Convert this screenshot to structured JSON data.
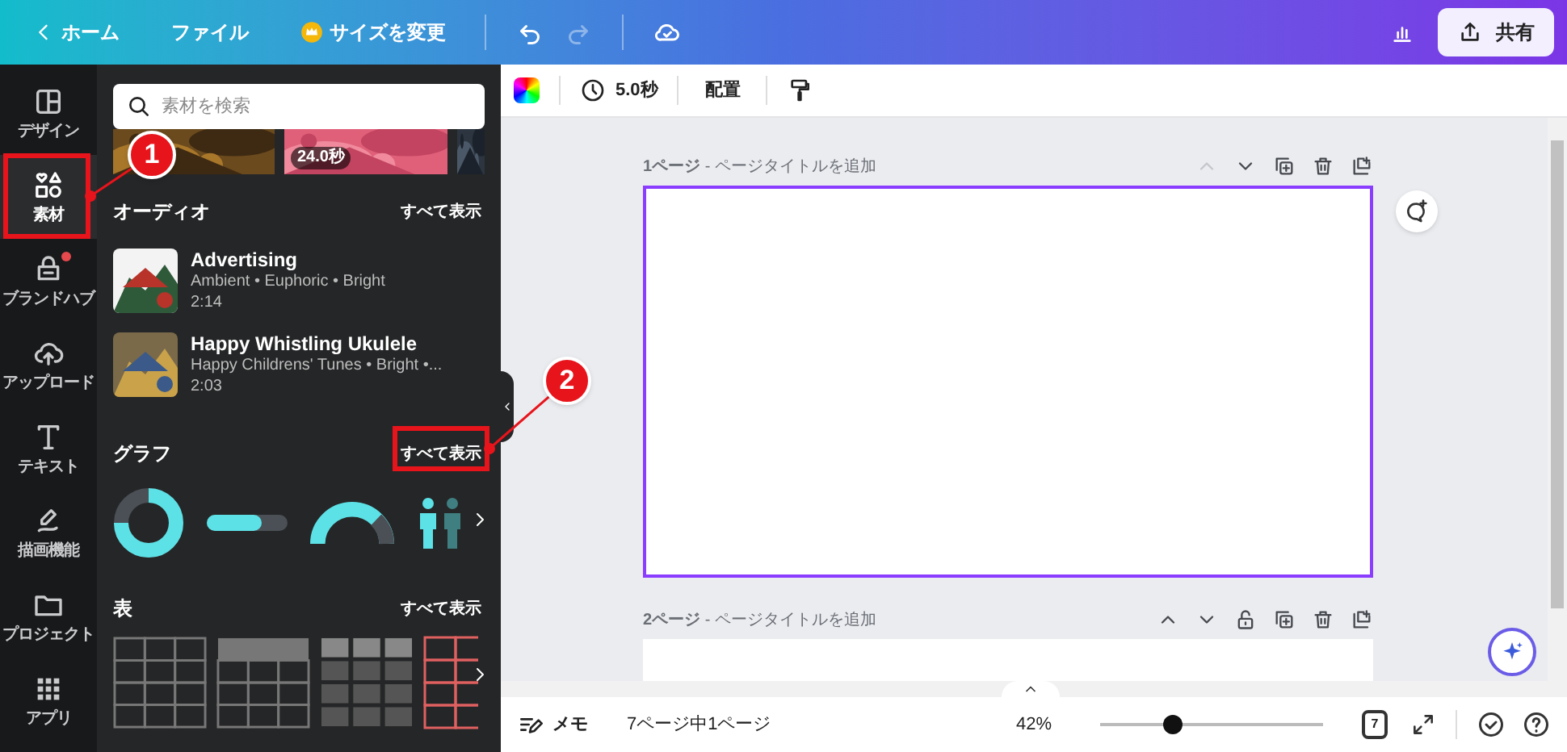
{
  "topbar": {
    "items": [
      {
        "kind": "back",
        "label": "ホーム"
      },
      {
        "kind": "plain",
        "label": "ファイル"
      },
      {
        "kind": "crown",
        "label": "サイズを変更"
      }
    ],
    "share": "共有"
  },
  "rail": [
    {
      "kind": "design",
      "label": "デザイン",
      "selected": false,
      "badge": false
    },
    {
      "kind": "elements",
      "label": "素材",
      "selected": true,
      "badge": false
    },
    {
      "kind": "brand",
      "label": "ブランドハブ",
      "selected": false,
      "badge": true
    },
    {
      "kind": "upload",
      "label": "アップロード",
      "selected": false,
      "badge": false
    },
    {
      "kind": "text",
      "label": "テキスト",
      "selected": false,
      "badge": false
    },
    {
      "kind": "draw",
      "label": "描画機能",
      "selected": false,
      "badge": false
    },
    {
      "kind": "folder",
      "label": "プロジェクト",
      "selected": false,
      "badge": false
    },
    {
      "kind": "apps",
      "label": "アプリ",
      "selected": false,
      "badge": false
    }
  ],
  "panel": {
    "search": {
      "placeholder": "素材を検索"
    },
    "video_badge": "24.0秒",
    "audio": {
      "title": "オーディオ",
      "link": "すべて表示",
      "tracks": [
        {
          "title": "Advertising",
          "subtitle": "Ambient • Euphoric • Bright",
          "duration": "2:14"
        },
        {
          "title": "Happy Whistling Ukulele",
          "subtitle": "Happy Childrens' Tunes • Bright •...",
          "duration": "2:03"
        }
      ]
    },
    "graph": {
      "title": "グラフ",
      "link": "すべて表示"
    },
    "table": {
      "title": "表",
      "link": "すべて表示"
    }
  },
  "toolbar": {
    "duration": "5.0秒",
    "arrange": "配置"
  },
  "pages": [
    {
      "title": "**1ページ** - ページタイトルを追加",
      "selected": true,
      "actions": [
        {
          "kind": "up",
          "disabled": true
        },
        {
          "kind": "down",
          "disabled": false
        },
        {
          "kind": "duplicate",
          "disabled": false
        },
        {
          "kind": "trash",
          "disabled": false
        },
        {
          "kind": "add",
          "disabled": false
        }
      ]
    },
    {
      "title": "**2ページ** - ページタイトルを追加",
      "selected": false,
      "actions": [
        {
          "kind": "up",
          "disabled": false
        },
        {
          "kind": "down",
          "disabled": false
        },
        {
          "kind": "lock",
          "disabled": false
        },
        {
          "kind": "duplicate",
          "disabled": false
        },
        {
          "kind": "trash",
          "disabled": false
        },
        {
          "kind": "add",
          "disabled": false
        }
      ]
    }
  ],
  "bottom": {
    "notes": "メモ",
    "page_count": "7ページ中1ページ",
    "zoom": "42%",
    "level": 0.34,
    "pages_badge": "7"
  },
  "annotations": [
    {
      "number": "1"
    },
    {
      "number": "2"
    }
  ]
}
